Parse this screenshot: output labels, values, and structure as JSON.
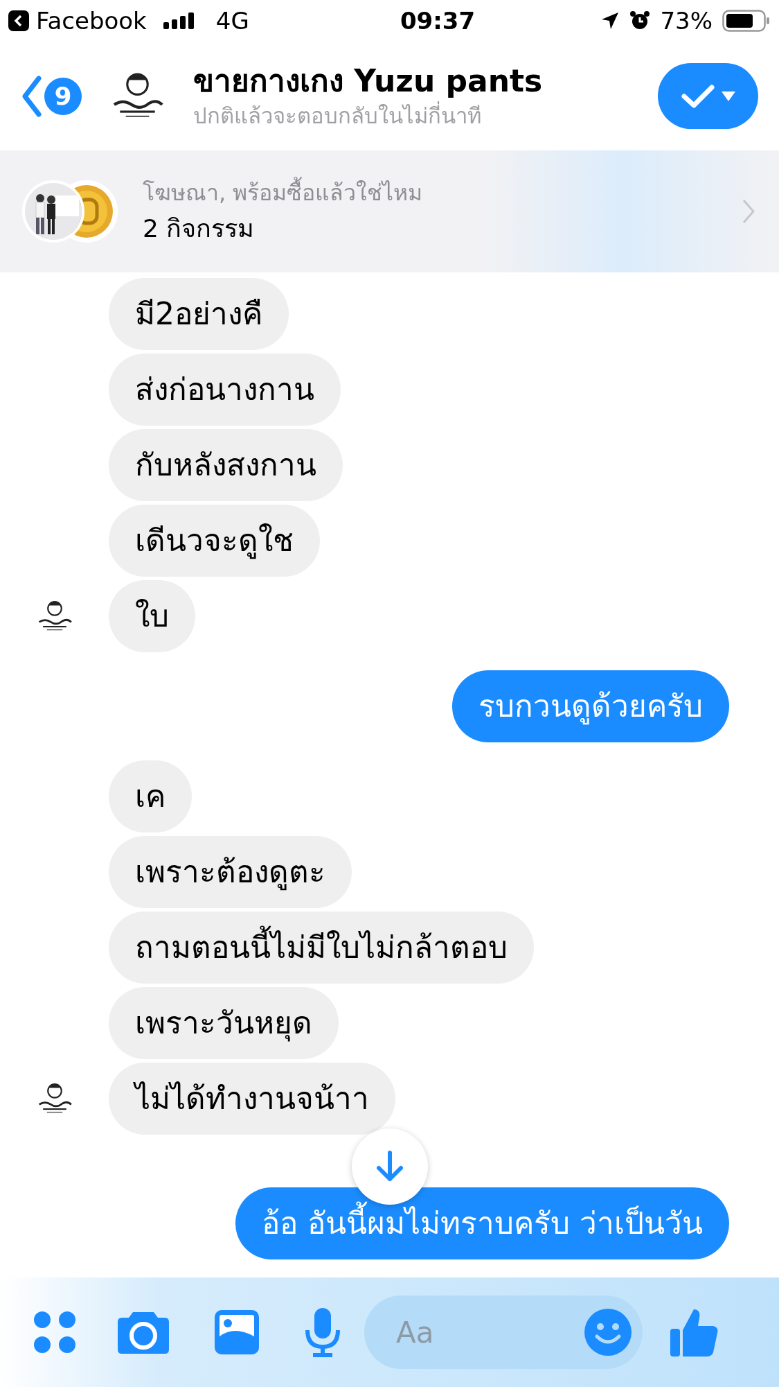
{
  "status_bar": {
    "back_app": "Facebook",
    "network": "4G",
    "time": "09:37",
    "battery": "73%"
  },
  "header": {
    "unread_count": "9",
    "title": "ขายกางเกง Yuzu pants",
    "subtitle": "ปกติแล้วจะตอบกลับในไม่กี่นาที"
  },
  "ad_banner": {
    "label": "โฆษณา, พร้อมซื้อแล้วใช่ไหม",
    "activity": "2 กิจกรรม"
  },
  "messages": [
    {
      "text": "มี2อย่างคื",
      "from_me": false,
      "avatar": false
    },
    {
      "text": "ส่งก่อนางกาน",
      "from_me": false,
      "avatar": false
    },
    {
      "text": "กับหลังสงกาน",
      "from_me": false,
      "avatar": false
    },
    {
      "text": "เดีนวจะดูใช",
      "from_me": false,
      "avatar": false
    },
    {
      "text": "ใบ",
      "from_me": false,
      "avatar": true
    },
    {
      "text": "รบกวนดูด้วยครับ",
      "from_me": true,
      "avatar": false
    },
    {
      "text": "เค",
      "from_me": false,
      "avatar": false
    },
    {
      "text": "เพราะต้องดูตะ",
      "from_me": false,
      "avatar": false
    },
    {
      "text": "ถามตอนนี้ไม่มีใบไม่กล้าตอบ",
      "from_me": false,
      "avatar": false
    },
    {
      "text": "เพราะวันหยุด",
      "from_me": false,
      "avatar": false
    },
    {
      "text": "ไม่ได้ทำงานจน้าา",
      "from_me": false,
      "avatar": true
    },
    {
      "text": "อ้อ อันนี้ผมไม่ทราบครับ ว่าเป็นวัน",
      "from_me": true,
      "avatar": false
    }
  ],
  "composer": {
    "placeholder": "Aa"
  }
}
